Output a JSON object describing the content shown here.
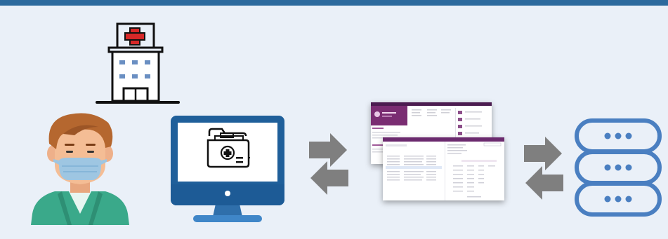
{
  "colors": {
    "header_bar": "#2c6a9d",
    "background": "#eaf0f8",
    "arrow": "#7f7f7f",
    "monitor_frame": "#1f5f9a",
    "database": "#4a7fc1",
    "app_accent": "#6b2a6e"
  },
  "icons": {
    "hospital": "hospital-building-icon",
    "patient": "masked-patient-icon",
    "computer": "desktop-monitor-icon",
    "medical_folder": "medical-record-folder-icon",
    "database": "database-server-icon",
    "arrows": "bidirectional-sync-arrows-icon"
  }
}
